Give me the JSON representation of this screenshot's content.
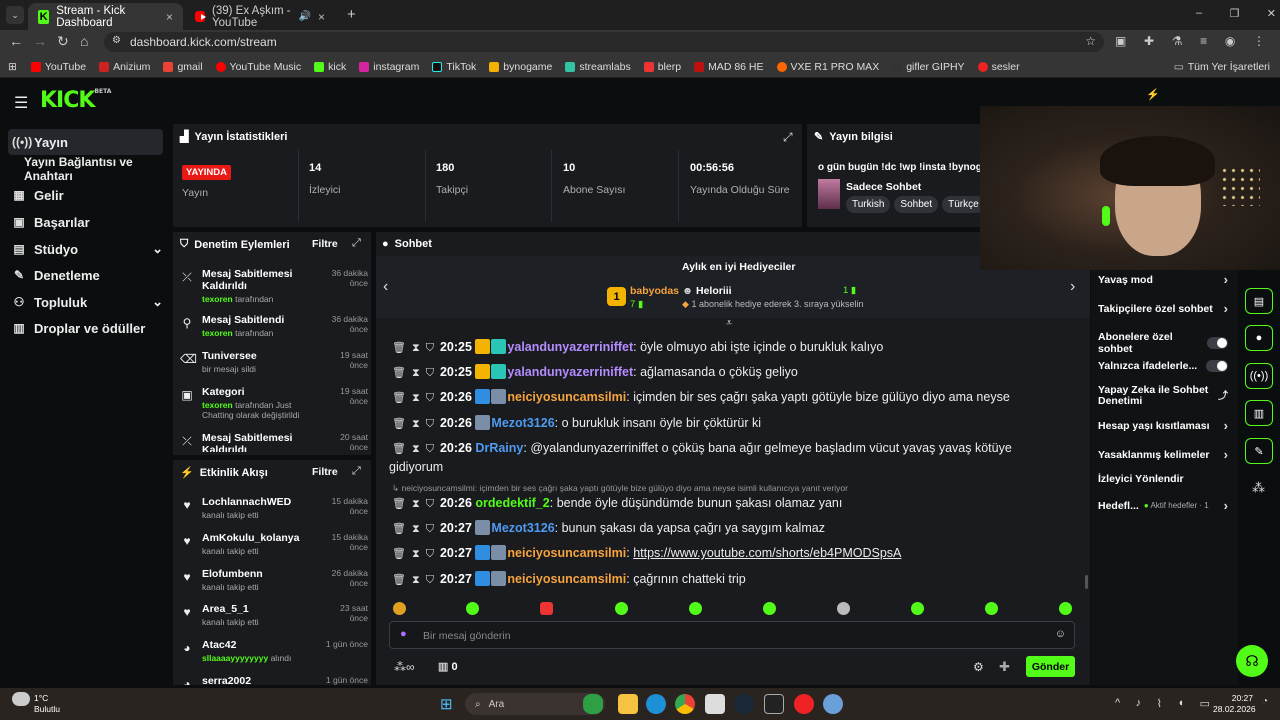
{
  "browser": {
    "tabs": [
      {
        "title": "Stream - Kick Dashboard",
        "close": "×"
      },
      {
        "title": "(39) Ex Aşkım - YouTube",
        "close": "×"
      }
    ],
    "new_tab": "+",
    "url": "dashboard.kick.com/stream",
    "bookmarks": [
      "YouTube",
      "Anizium",
      "gmail",
      "YouTube Music",
      "kick",
      "instagram",
      "TikTok",
      "bynogame",
      "streamlabs",
      "blerp",
      "MAD 86 HE",
      "VXE R1 PRO MAX",
      "gifler GIPHY",
      "sesler"
    ],
    "all_bookmarks": "Tüm Yer İşaretleri",
    "win_controls": [
      "–",
      "❐",
      "✕"
    ]
  },
  "brand": {
    "logo": "KICK",
    "logo_sup": "BETA",
    "accent": "#53fc18"
  },
  "sidebar": {
    "items": [
      {
        "label": "Yayın",
        "icon": "((•))"
      },
      {
        "label": "Yayın Bağlantısı ve Anahtarı",
        "icon": ""
      },
      {
        "label": "Gelir",
        "icon": "▦"
      },
      {
        "label": "Başarılar",
        "icon": "▣"
      },
      {
        "label": "Stüdyo",
        "icon": "▤",
        "chev": "⌄"
      },
      {
        "label": "Denetleme",
        "icon": "🔧"
      },
      {
        "label": "Topluluk",
        "icon": "👥",
        "chev": "⌄"
      },
      {
        "label": "Droplar ve ödüller",
        "icon": "▥"
      }
    ]
  },
  "stats": {
    "title": "Yayın İstatistikleri",
    "live_badge": "YAYINDA",
    "live_label": "Yayın",
    "items": [
      {
        "value": "14",
        "label": "İzleyici"
      },
      {
        "value": "180",
        "label": "Takipçi"
      },
      {
        "value": "10",
        "label": "Abone Sayısı"
      },
      {
        "value": "00:56:56",
        "label": "Yayında Olduğu Süre"
      }
    ]
  },
  "info": {
    "title": "Yayın bilgisi",
    "stream_title": "o gün bugün !dc !wp !insta !bynogam",
    "category": "Sadece Sohbet",
    "tags": [
      "Turkish",
      "Sohbet",
      "Türkçe"
    ]
  },
  "modlog": {
    "title": "Denetim Eylemleri",
    "filter": "Filtre",
    "items": [
      {
        "icon": "⤫",
        "title": "Mesaj Sabitlemesi Kaldırıldı",
        "user": "texoren",
        "suffix": "tarafından",
        "time": "36 dakika önce"
      },
      {
        "icon": "📌",
        "title": "Mesaj Sabitlendi",
        "user": "texoren",
        "suffix": "tarafından",
        "time": "36 dakika önce"
      },
      {
        "icon": "🗑",
        "title": "Tuniversee",
        "user": "",
        "suffix": "bir mesajı sildi",
        "time": "19 saat önce"
      },
      {
        "icon": "▣",
        "title": "Kategori",
        "user": "texoren",
        "suffix": "tarafından Just Chatting olarak değiştirildi",
        "time": "19 saat önce"
      },
      {
        "icon": "⤫",
        "title": "Mesaj Sabitlemesi Kaldırıldı",
        "user": "",
        "suffix": "",
        "time": "20 saat önce"
      }
    ]
  },
  "activity": {
    "title": "Etkinlik Akışı",
    "filter": "Filtre",
    "items": [
      {
        "icon": "♥",
        "name": "LochlannachWED",
        "sub": "kanalı takip etti",
        "time": "15 dakika önce"
      },
      {
        "icon": "♥",
        "name": "AmKokulu_kolanya",
        "sub": "kanalı takip etti",
        "time": "15 dakika önce"
      },
      {
        "icon": "♥",
        "name": "Elofumbenn",
        "sub": "kanalı takip etti",
        "time": "26 dakika önce"
      },
      {
        "icon": "♥",
        "name": "Area_5_1",
        "sub": "kanalı takip etti",
        "time": "23 saat önce"
      },
      {
        "icon": "◕",
        "name": "Atac42",
        "sub": "sllaaaayyyyyyyy",
        "sub2": "alındı",
        "time": "1 gün önce"
      },
      {
        "icon": "◕",
        "name": "serra2002",
        "sub": "",
        "time": "1 gün önce"
      }
    ]
  },
  "chat": {
    "title": "Sohbet",
    "gifter_title": "Aylık en iyi Hediyeciler",
    "gifter1": {
      "rank": "1",
      "name": "babyodas",
      "count": "7"
    },
    "gifter2": {
      "name": "Heloriii",
      "count": "1",
      "note": "1 abonelik hediye ederek 3. sıraya yükselin"
    },
    "messages": [
      {
        "time": "20:25",
        "user": "yalandunyazerriniffet",
        "color": "#b58cff",
        "badges": [
          "bcr",
          "bteal"
        ],
        "text": "öyle olmuyo abi işte içinde o burukluk kalıyo"
      },
      {
        "time": "20:25",
        "user": "yalandunyazerriniffet",
        "color": "#b58cff",
        "badges": [
          "bcr",
          "bteal"
        ],
        "text": "ağlamasanda o çöküş geliyo"
      },
      {
        "time": "20:26",
        "user": "neiciyosuncamsilmi",
        "color": "#f6a33c",
        "badges": [
          "bblue",
          "bpic"
        ],
        "text": "içimden bir ses çağrı şaka yaptı götüyle bize gülüyo diyo ama neyse"
      },
      {
        "time": "20:26",
        "user": "Mezot3126",
        "color": "#4f9bf0",
        "badges": [
          "bpic"
        ],
        "text": "o burukluk insanı öyle bir çöktürür ki"
      },
      {
        "time": "20:26",
        "user": "DrRainy",
        "color": "#4f9bf0",
        "badges": [],
        "text": "@yalandunyazerriniffet o çöküş bana ağır gelmeye başladım vücut yavaş yavaş kötüye"
      },
      {
        "time": "",
        "user": "",
        "color": "#ececec",
        "badges": [],
        "text": "gidiyorum"
      },
      {
        "time": "20:26",
        "user": "ordedektif_2",
        "color": "#53fc18",
        "badges": [],
        "text": "bende öyle düşündümde bunun şakası olamaz yanı"
      },
      {
        "time": "20:27",
        "user": "Mezot3126",
        "color": "#4f9bf0",
        "badges": [
          "bpic"
        ],
        "text": "bunun şakası da yapsa çağrı ya saygım kalmaz"
      },
      {
        "time": "20:27",
        "user": "neiciyosuncamsilmi",
        "color": "#f6a33c",
        "badges": [
          "bblue",
          "bpic"
        ],
        "text": "https://www.youtube.com/shorts/eb4PMODSpsA"
      },
      {
        "time": "20:27",
        "user": "neiciyosuncamsilmi",
        "color": "#f6a33c",
        "badges": [
          "bblue",
          "bpic"
        ],
        "text": "çağrının chatteki trip"
      }
    ],
    "reply_note": "neiciyosuncamsilmi: içimden bir ses çağrı şaka yaptı götüyle bize gülüyo diyo ama neyse isimli kullanıcıya yanıt veriyor",
    "placeholder": "Bir mesaj gönderin",
    "points": "0",
    "send": "Gönder"
  },
  "settings": {
    "items": [
      {
        "label": "Yavaş mod",
        "type": "chev"
      },
      {
        "label": "Takipçilere özel sohbet",
        "type": "chev"
      },
      {
        "label": "Abonelere özel sohbet",
        "type": "toggle"
      },
      {
        "label": "Yalnızca ifadelerle...",
        "type": "toggle"
      },
      {
        "label": "Yapay Zeka ile Sohbet Denetimi",
        "type": "ext"
      },
      {
        "label": "Hesap yaşı kısıtlaması",
        "type": "chev"
      },
      {
        "label": "Yasaklanmış kelimeler",
        "type": "chev"
      },
      {
        "label": "İzleyici Yönlendir",
        "type": "none"
      },
      {
        "label": "Hedefl...",
        "type": "chev",
        "extra": "Aktif hedefler · 1"
      }
    ]
  },
  "taskbar": {
    "weather_temp": "1°C",
    "weather_desc": "Bulutlu",
    "search": "Ara",
    "time": "20:27",
    "date": "28.02.2026"
  }
}
